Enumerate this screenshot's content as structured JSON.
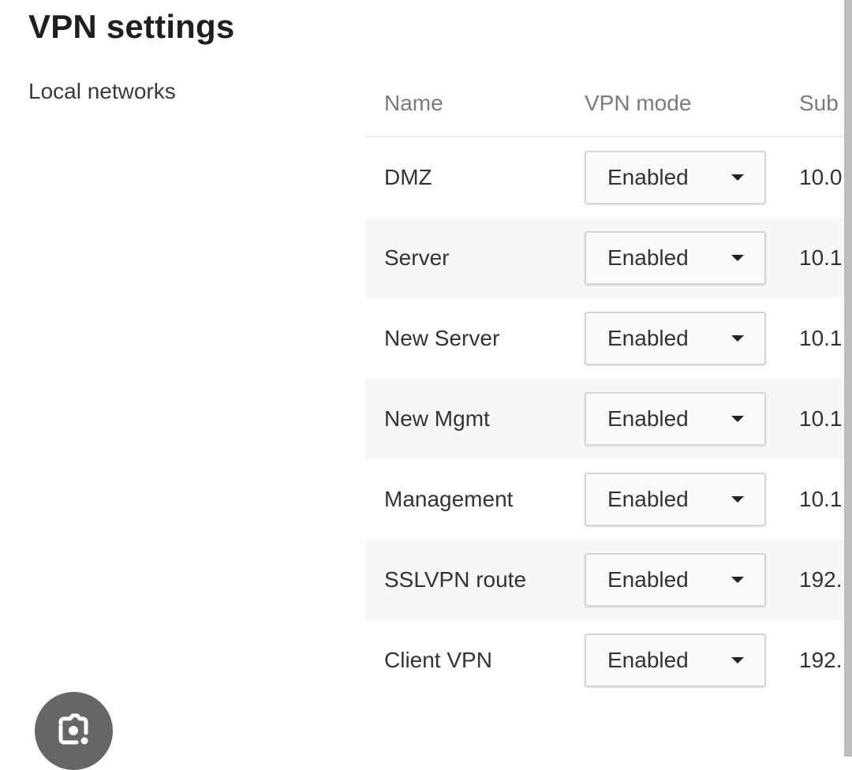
{
  "page": {
    "title": "VPN settings",
    "section_label": "Local networks"
  },
  "table": {
    "columns": {
      "name": "Name",
      "vpn_mode": "VPN mode",
      "subnet": "Sub"
    },
    "rows": [
      {
        "name": "DMZ",
        "vpn_mode": "Enabled",
        "subnet": "10.0"
      },
      {
        "name": "Server",
        "vpn_mode": "Enabled",
        "subnet": "10.1."
      },
      {
        "name": "New Server",
        "vpn_mode": "Enabled",
        "subnet": "10.1"
      },
      {
        "name": "New Mgmt",
        "vpn_mode": "Enabled",
        "subnet": "10.1"
      },
      {
        "name": "Management",
        "vpn_mode": "Enabled",
        "subnet": "10.1."
      },
      {
        "name": "SSLVPN route",
        "vpn_mode": "Enabled",
        "subnet": "192."
      },
      {
        "name": "Client VPN",
        "vpn_mode": "Enabled",
        "subnet": "192."
      }
    ]
  },
  "icons": {
    "dropdown": "caret-down-icon",
    "lens": "google-lens-icon"
  }
}
